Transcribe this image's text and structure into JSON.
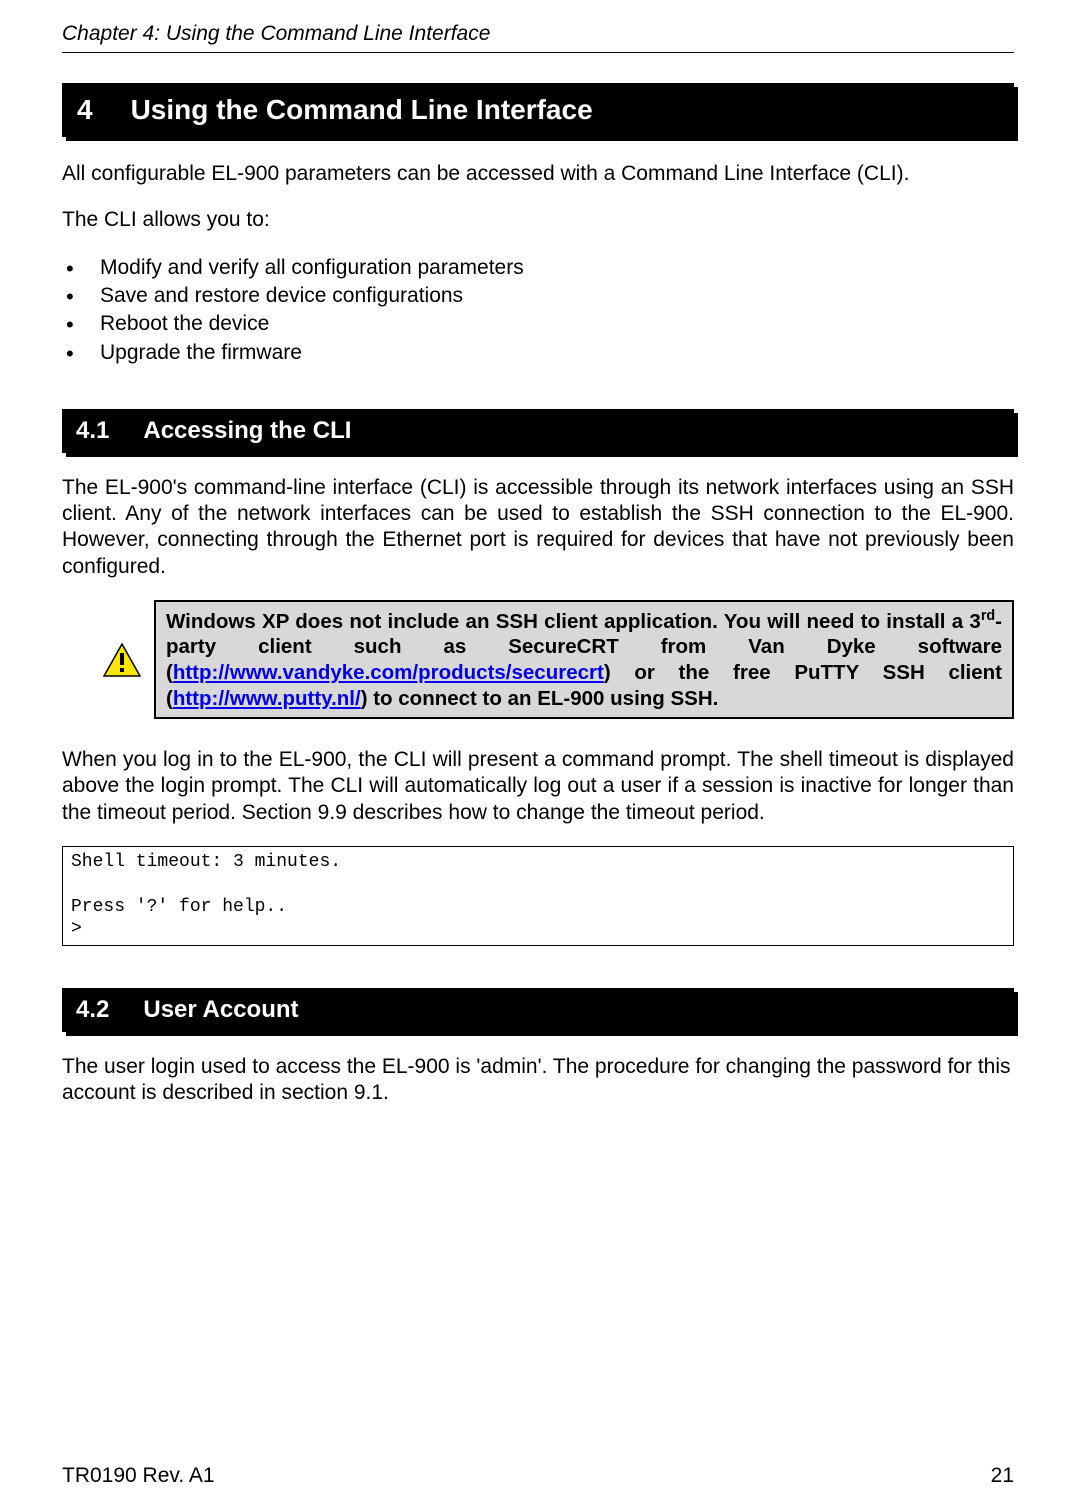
{
  "header": {
    "chapter_line": "Chapter 4: Using the Command Line Interface"
  },
  "section4": {
    "num": "4",
    "title": "Using the Command Line Interface",
    "intro_p1": "All configurable EL-900 parameters can be accessed with a Command Line Interface (CLI).",
    "intro_p2": "The CLI allows you to:",
    "bullets": [
      "Modify and verify all configuration parameters",
      "Save and restore device configurations",
      "Reboot the device",
      "Upgrade the firmware"
    ]
  },
  "section41": {
    "num": "4.1",
    "title": "Accessing the CLI",
    "p1": "The EL-900's command-line interface (CLI) is accessible through its network interfaces using an SSH client. Any of the network interfaces can be used to establish the SSH connection to the EL-900. However, connecting through the Ethernet port is required for devices that have not previously been configured.",
    "callout": {
      "part1": "Windows XP does not include an SSH client application. You will need to install a 3",
      "sup": "rd",
      "part2": "-party client such as SecureCRT from Van Dyke software (",
      "link1_text": "http://www.vandyke.com/products/securecrt",
      "part3": ") or the free PuTTY SSH client (",
      "link2_text": "http://www.putty.nl/",
      "part4": ") to connect to an EL-900 using SSH."
    },
    "p2": "When you log in to the EL-900, the CLI will present a command prompt. The shell timeout is displayed above the login prompt. The CLI will automatically log out a user if a session is inactive for longer than the timeout period. Section 9.9 describes how to change the timeout period.",
    "code": "Shell timeout: 3 minutes.\n\nPress '?' for help..\n>"
  },
  "section42": {
    "num": "4.2",
    "title": "User Account",
    "p1": "The user login used to access the EL-900 is 'admin'. The procedure for changing the password for this account is described in section 9.1."
  },
  "footer": {
    "left": "TR0190 Rev. A1",
    "right": "21"
  }
}
